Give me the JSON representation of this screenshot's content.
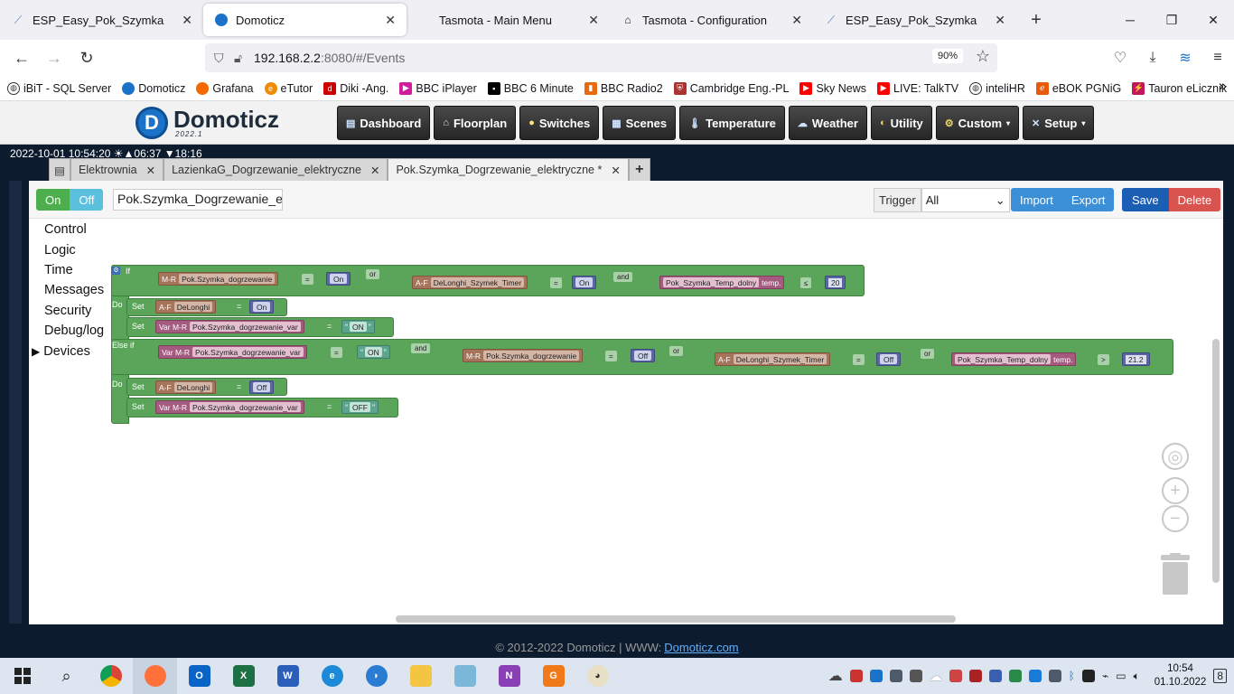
{
  "browser": {
    "tabs": [
      {
        "title": "ESP_Easy_Pok_Szymka",
        "icon": "esp-icon",
        "active": false
      },
      {
        "title": "Domoticz",
        "icon": "domoticz-icon",
        "active": true
      },
      {
        "title": "Tasmota - Main Menu",
        "icon": "blank-icon",
        "active": false
      },
      {
        "title": "Tasmota - Configuration",
        "icon": "tasmota-icon",
        "active": false
      },
      {
        "title": "ESP_Easy_Pok_Szymka",
        "icon": "esp-icon",
        "active": false
      }
    ],
    "url_host": "192.168.2.2",
    "url_rest": ":8080/#/Events",
    "zoom": "90%",
    "bookmarks": [
      "iBiT - SQL Server",
      "Domoticz",
      "Grafana",
      "eTutor",
      "Diki -Ang.",
      "BBC iPlayer",
      "BBC 6 Minute",
      "BBC Radio2",
      "Cambridge Eng.-PL",
      "Sky News",
      "LIVE: TalkTV",
      "inteliHR",
      "eBOK PGNiG",
      "Tauron eLicznik"
    ]
  },
  "domoticz": {
    "logo_text": "Domoticz",
    "logo_version": "2022.1",
    "menu": [
      {
        "label": "Dashboard",
        "icon": "dashboard-icon"
      },
      {
        "label": "Floorplan",
        "icon": "floorplan-icon"
      },
      {
        "label": "Switches",
        "icon": "bulb-icon"
      },
      {
        "label": "Scenes",
        "icon": "scenes-icon"
      },
      {
        "label": "Temperature",
        "icon": "thermometer-icon"
      },
      {
        "label": "Weather",
        "icon": "weather-icon"
      },
      {
        "label": "Utility",
        "icon": "utility-icon"
      },
      {
        "label": "Custom",
        "icon": "gear-icon",
        "dropdown": true
      },
      {
        "label": "Setup",
        "icon": "wrench-icon",
        "dropdown": true
      }
    ],
    "clock": "2022-10-01 10:54:20 ☀▲06:37 ▼18:16",
    "event_tabs": [
      {
        "label": "Elektrownia",
        "active": false
      },
      {
        "label": "LazienkaG_Dogrzewanie_elektryczne",
        "active": false
      },
      {
        "label": "Pok.Szymka_Dogrzewanie_elektryczne *",
        "active": true
      }
    ],
    "toolbar": {
      "on": "On",
      "off": "Off",
      "event_name": "Pok.Szymka_Dogrzewanie_ele",
      "trigger_label": "Trigger",
      "trigger_value": "All",
      "import": "Import",
      "export": "Export",
      "save": "Save",
      "delete": "Delete"
    },
    "categories": [
      "Control",
      "Logic",
      "Time",
      "Messages",
      "Security",
      "Debug/log",
      "Devices"
    ],
    "blocks": {
      "if": "If",
      "do": "Do",
      "else_if": "Else if",
      "set": "Set",
      "or": "or",
      "and": "and",
      "eq": "=",
      "le": "≤",
      "gt": ">",
      "mr": "M-R",
      "af": "A-F",
      "var_mr": "Var M-R",
      "temp": "temp.",
      "dev_dogrzewanie": "Pok.Szymka_dogrzewanie",
      "dev_timer": "DeLonghi_Szymek_Timer",
      "dev_temp": "Pok_Szymka_Temp_dolny",
      "dev_delonghi": "DeLonghi",
      "var_dogrzewanie": "Pok.Szymka_dogrzewanie_var",
      "on": "On",
      "off": "Off",
      "str_on": "ON",
      "str_off": "OFF",
      "n20": "20",
      "n212": "21.2"
    },
    "footer_text": "© 2012-2022 Domoticz | WWW:",
    "footer_link": "Domoticz.com"
  },
  "taskbar": {
    "apps": [
      "start",
      "search",
      "chrome",
      "firefox",
      "outlook",
      "excel",
      "word",
      "edge",
      "teams",
      "explorer",
      "notepad",
      "onenote",
      "pdf",
      "paint"
    ],
    "time": "10:54",
    "date": "01.10.2022",
    "notifications": "8"
  }
}
